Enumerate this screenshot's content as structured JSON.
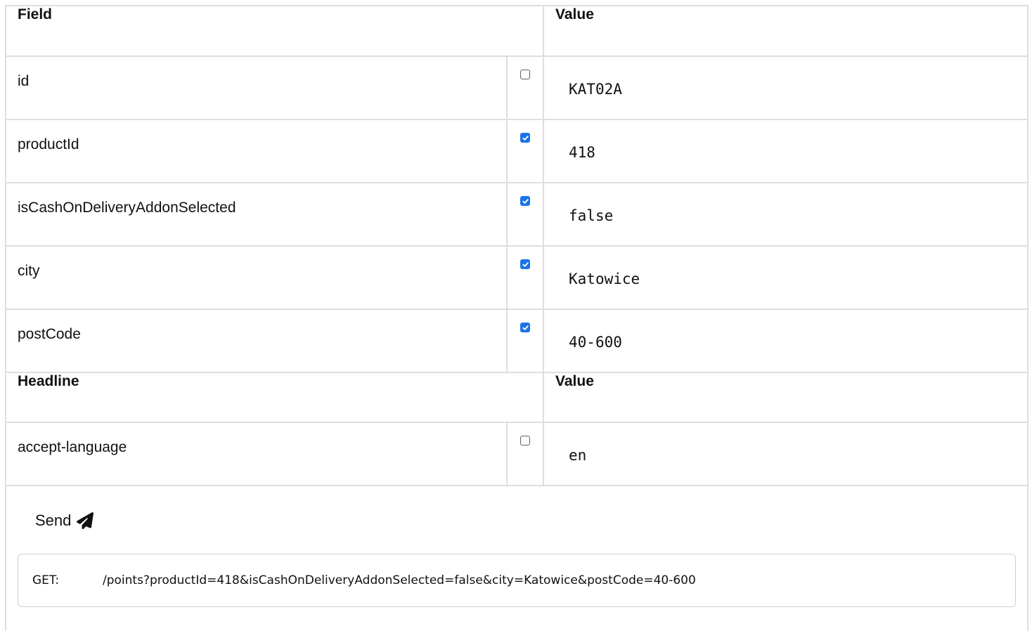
{
  "fields_header": {
    "field": "Field",
    "value": "Value"
  },
  "fields": [
    {
      "name": "id",
      "checked": false,
      "value": "KAT02A"
    },
    {
      "name": "productId",
      "checked": true,
      "value": "418"
    },
    {
      "name": "isCashOnDeliveryAddonSelected",
      "checked": true,
      "value": "false"
    },
    {
      "name": "city",
      "checked": true,
      "value": "Katowice"
    },
    {
      "name": "postCode",
      "checked": true,
      "value": "40-600"
    }
  ],
  "headers_header": {
    "headline": "Headline",
    "value": "Value"
  },
  "headers": [
    {
      "name": "accept-language",
      "checked": false,
      "value": "en"
    }
  ],
  "send": {
    "label": "Send",
    "icon": "paper-plane-icon"
  },
  "request": {
    "method": "GET:",
    "path": "/points?productId=418&isCashOnDeliveryAddonSelected=false&city=Katowice&postCode=40-600"
  },
  "colors": {
    "checkbox_checked": "#1a73e8",
    "border": "#dedede"
  }
}
